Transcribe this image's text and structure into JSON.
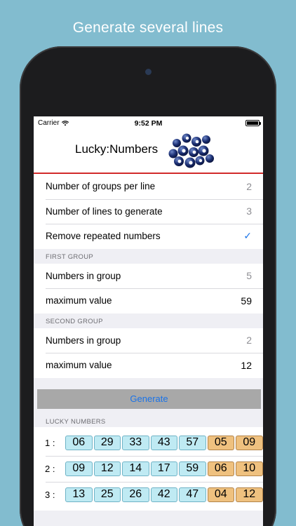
{
  "promo": {
    "headline": "Generate several lines"
  },
  "status_bar": {
    "carrier": "Carrier",
    "time": "9:52 PM"
  },
  "header": {
    "title": "Lucky:Numbers"
  },
  "settings": {
    "groups_per_line": {
      "label": "Number of groups per line",
      "value": "2"
    },
    "lines_to_generate": {
      "label": "Number of lines to generate",
      "value": "3"
    },
    "remove_repeated": {
      "label": "Remove repeated numbers",
      "checked": "✓"
    }
  },
  "first_group": {
    "title": "FIRST GROUP",
    "numbers_in_group": {
      "label": "Numbers in group",
      "value": "5"
    },
    "maximum_value": {
      "label": "maximum value",
      "value": "59"
    }
  },
  "second_group": {
    "title": "SECOND GROUP",
    "numbers_in_group": {
      "label": "Numbers in group",
      "value": "2"
    },
    "maximum_value": {
      "label": "maximum value",
      "value": "12"
    }
  },
  "generate_label": "Generate",
  "lucky": {
    "title": "LUCKY NUMBERS",
    "lines": [
      {
        "label": "1 :",
        "main": [
          "06",
          "29",
          "33",
          "43",
          "57"
        ],
        "extra": [
          "05",
          "09"
        ]
      },
      {
        "label": "2 :",
        "main": [
          "09",
          "12",
          "14",
          "17",
          "59"
        ],
        "extra": [
          "06",
          "10"
        ]
      },
      {
        "label": "3 :",
        "main": [
          "13",
          "25",
          "26",
          "42",
          "47"
        ],
        "extra": [
          "04",
          "12"
        ]
      }
    ]
  },
  "colors": {
    "background": "#82bccf",
    "accent_blue": "#1a73e8",
    "header_rule": "#d12a2a",
    "main_ball_fill": "#bfeaf3",
    "extra_ball_fill": "#efc17f"
  },
  "icons": {
    "wifi": "wifi-icon",
    "battery": "battery-icon",
    "logo": "lottery-balls-logo-icon",
    "check": "checkmark-icon"
  }
}
